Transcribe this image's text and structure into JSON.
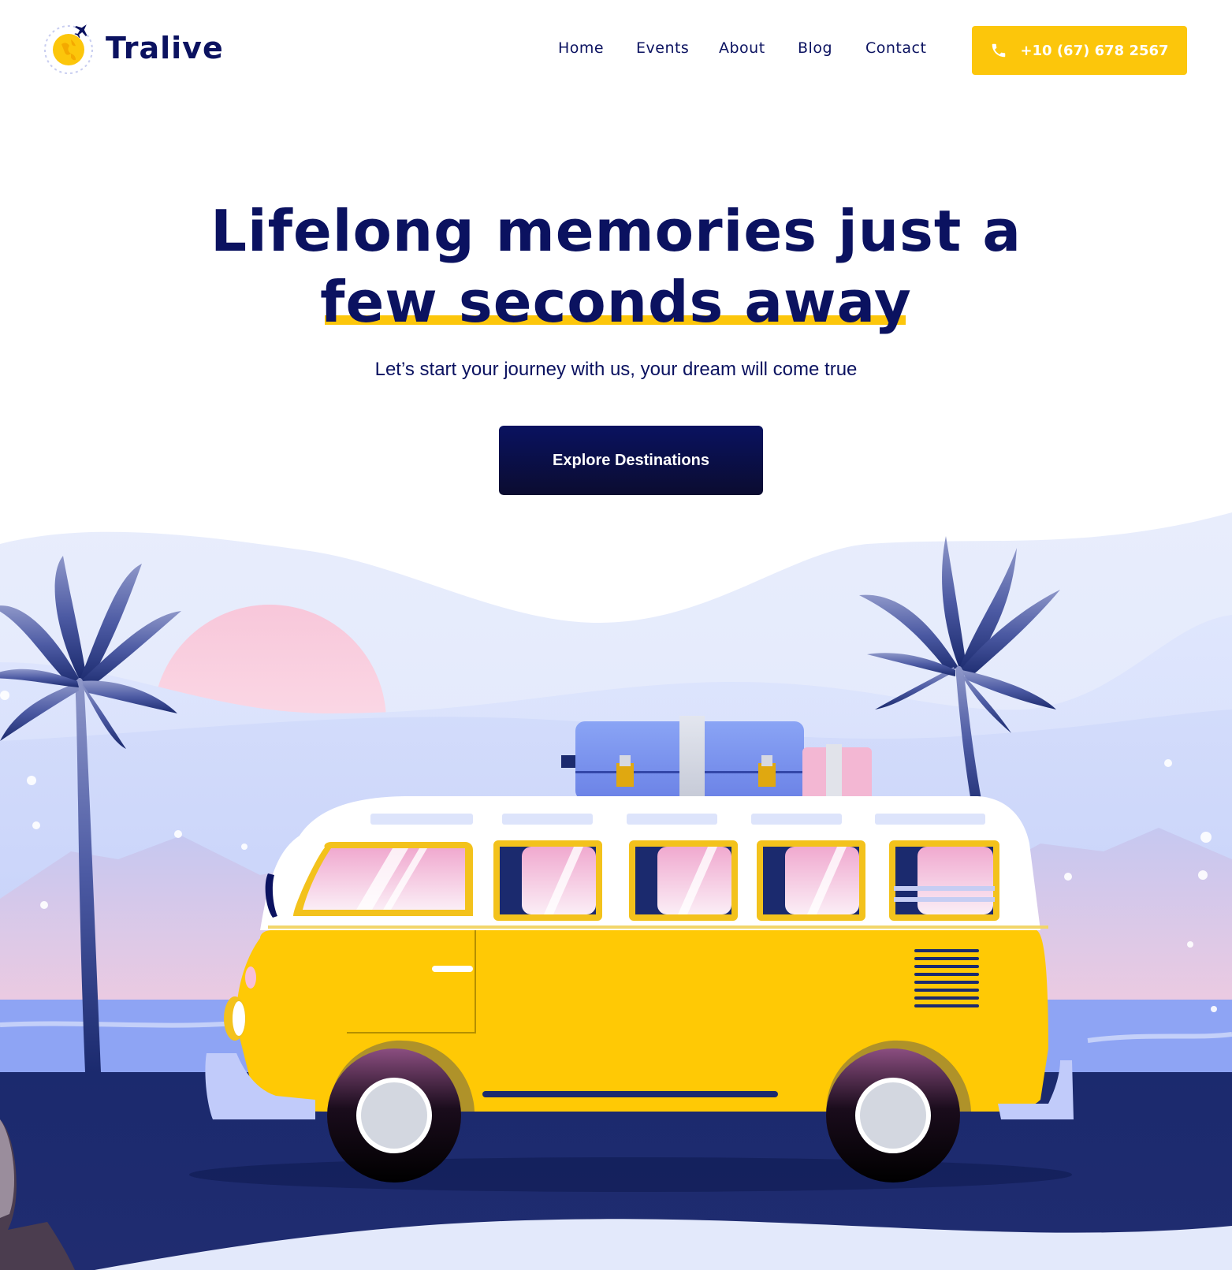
{
  "brand": {
    "name": "Tralive"
  },
  "nav": {
    "items": [
      {
        "label": "Home"
      },
      {
        "label": "Events"
      },
      {
        "label": "About"
      },
      {
        "label": "Blog"
      },
      {
        "label": "Contact"
      }
    ],
    "phone": "+10 (67) 678 2567"
  },
  "hero": {
    "title_line1": "Lifelong memories just a",
    "title_line2": "few seconds away",
    "subtitle": "Let’s start your journey with us, your dream will come true",
    "cta_label": "Explore Destinations"
  },
  "colors": {
    "accent": "#fcc60b",
    "navy": "#0b1260",
    "road": "#1b2a6e",
    "sky_light": "#dbe3fb",
    "van_yellow": "#ffc905"
  },
  "icons": {
    "logo": "globe-plane-icon",
    "phone": "phone-icon"
  }
}
